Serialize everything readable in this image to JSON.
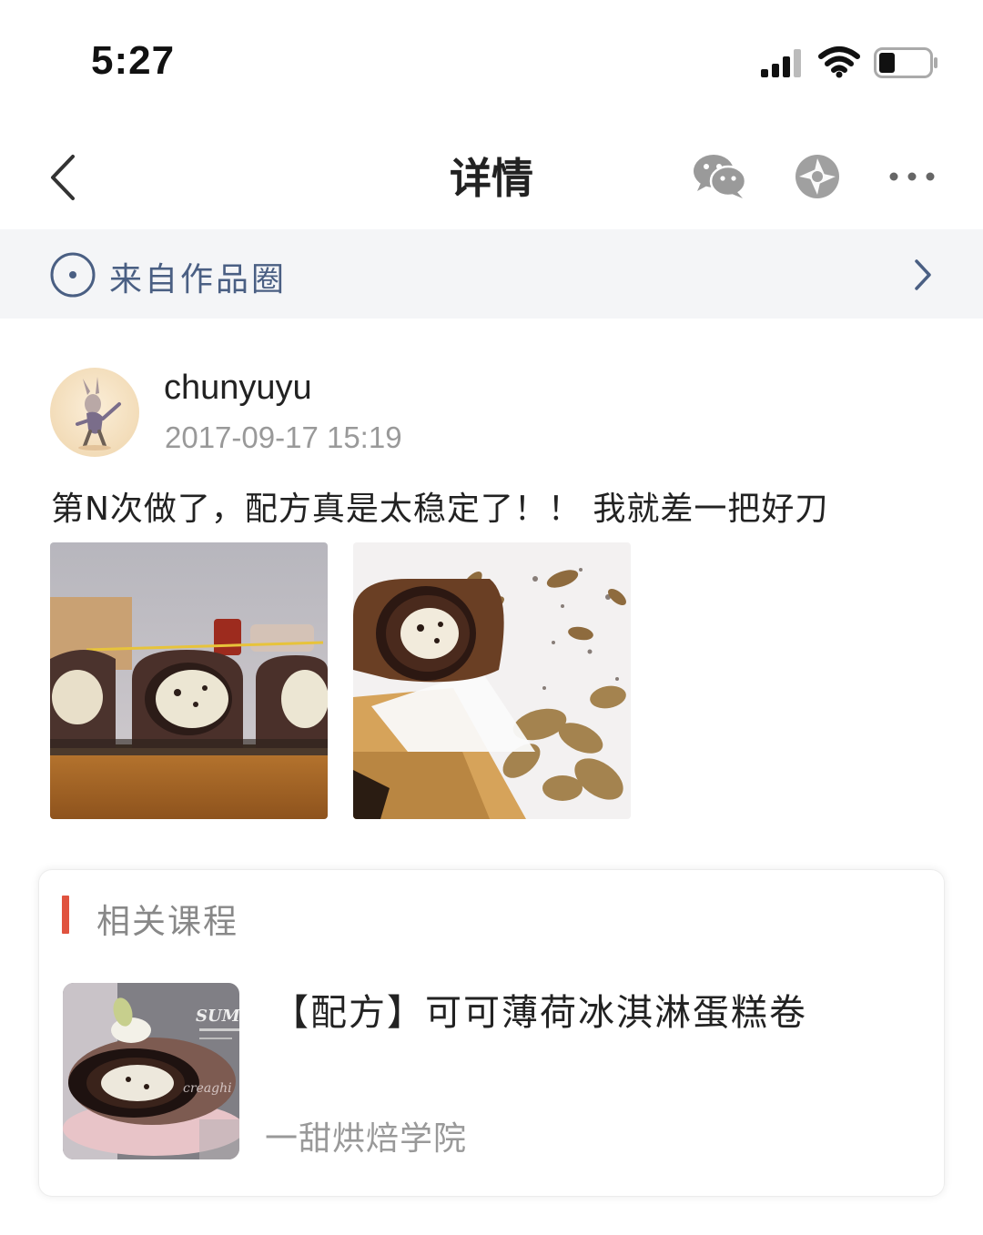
{
  "status_bar": {
    "time": "5:27"
  },
  "nav": {
    "title": "详情",
    "icons": [
      "back-icon",
      "wechat-icon",
      "moments-icon",
      "more-icon"
    ]
  },
  "source": {
    "label": "来自作品圈",
    "icon": "circle-dot-icon",
    "accent_color": "#4a5f83"
  },
  "post": {
    "author": "chunyuyu",
    "timestamp": "2017-09-17 15:19",
    "text": "第N次做了，配方真是太稳定了！！ 我就差一把好刀",
    "photos": [
      "cake-roll-slices-photo",
      "cake-roll-on-board-photo"
    ]
  },
  "related": {
    "section_title": "相关课程",
    "accent_color": "#e0533f",
    "course": {
      "title": "【配方】可可薄荷冰淇淋蛋糕卷",
      "provider": "一甜烘焙学院",
      "thumb_text": "SUM"
    }
  }
}
